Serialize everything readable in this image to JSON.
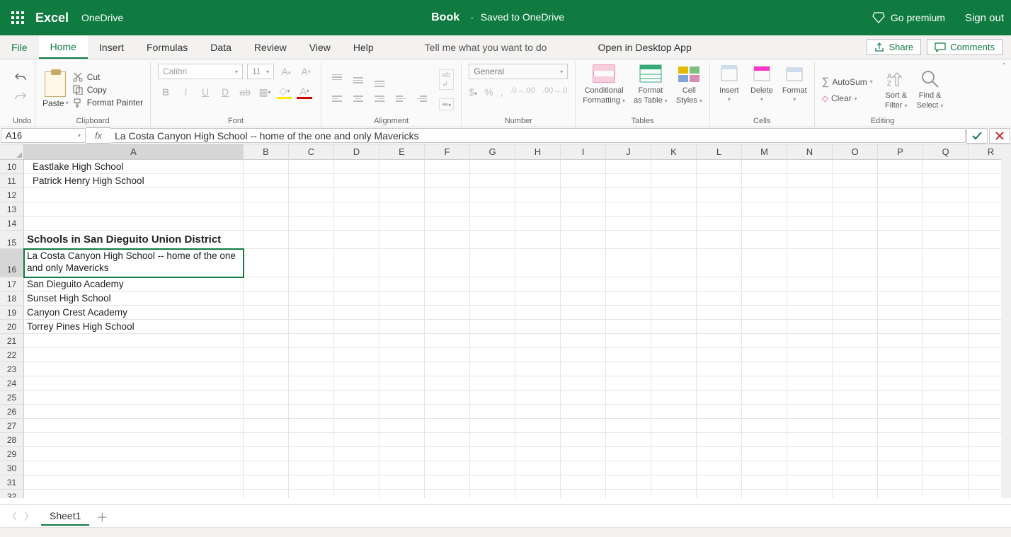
{
  "title_bar": {
    "app_name": "Excel",
    "location": "OneDrive",
    "doc_name": "Book",
    "doc_dash": "-",
    "doc_status": "Saved to OneDrive",
    "go_premium": "Go premium",
    "sign_out": "Sign out"
  },
  "tabs": {
    "file": "File",
    "home": "Home",
    "insert": "Insert",
    "formulas": "Formulas",
    "data": "Data",
    "review": "Review",
    "view": "View",
    "help": "Help",
    "tell_me": "Tell me what you want to do",
    "open_desktop": "Open in Desktop App",
    "share": "Share",
    "comments": "Comments"
  },
  "ribbon": {
    "undo_label": "Undo",
    "paste": "Paste",
    "cut": "Cut",
    "copy": "Copy",
    "format_painter": "Format Painter",
    "clipboard": "Clipboard",
    "font_name": "Calibri",
    "font_size": "11",
    "font": "Font",
    "alignment": "Alignment",
    "num_format": "General",
    "number": "Number",
    "cond_fmt_l1": "Conditional",
    "cond_fmt_l2": "Formatting",
    "fmt_table_l1": "Format",
    "fmt_table_l2": "as Table",
    "cell_styles_l1": "Cell",
    "cell_styles_l2": "Styles",
    "tables": "Tables",
    "insert": "Insert",
    "delete": "Delete",
    "format": "Format",
    "cells": "Cells",
    "autosum": "AutoSum",
    "clear": "Clear",
    "sort_l1": "Sort &",
    "sort_l2": "Filter",
    "find_l1": "Find &",
    "find_l2": "Select",
    "editing": "Editing"
  },
  "formula": {
    "name_box": "A16",
    "fx": "fx",
    "value": "La Costa Canyon High School -- home of the one and only Mavericks"
  },
  "columns": [
    "A",
    "B",
    "C",
    "D",
    "E",
    "F",
    "G",
    "H",
    "I",
    "J",
    "K",
    "L",
    "M",
    "N",
    "O",
    "P",
    "Q",
    "R"
  ],
  "col_width_A": 310,
  "col_width_other": 64,
  "rows": [
    {
      "num": 10,
      "a_indent": true,
      "a": "Eastlake High School"
    },
    {
      "num": 11,
      "a_indent": true,
      "a": "Patrick Henry High School"
    },
    {
      "num": 12,
      "a": ""
    },
    {
      "num": 13,
      "a": ""
    },
    {
      "num": 14,
      "a": ""
    },
    {
      "num": 15,
      "a": "Schools in San Dieguito Union District",
      "bold": true,
      "tallish": true
    },
    {
      "num": 16,
      "a": "La Costa Canyon High School -- home of the one and only Mavericks",
      "tall": true,
      "selected": true
    },
    {
      "num": 17,
      "a": "San Dieguito Academy"
    },
    {
      "num": 18,
      "a": "Sunset High School"
    },
    {
      "num": 19,
      "a": "Canyon Crest Academy"
    },
    {
      "num": 20,
      "a": "Torrey Pines High School"
    },
    {
      "num": 21,
      "a": ""
    },
    {
      "num": 22,
      "a": ""
    },
    {
      "num": 23,
      "a": ""
    },
    {
      "num": 24,
      "a": ""
    },
    {
      "num": 25,
      "a": ""
    },
    {
      "num": 26,
      "a": ""
    },
    {
      "num": 27,
      "a": ""
    },
    {
      "num": 28,
      "a": ""
    },
    {
      "num": 29,
      "a": ""
    },
    {
      "num": 30,
      "a": ""
    },
    {
      "num": 31,
      "a": ""
    },
    {
      "num": 32,
      "a": ""
    }
  ],
  "sheet_bar": {
    "sheet": "Sheet1"
  }
}
